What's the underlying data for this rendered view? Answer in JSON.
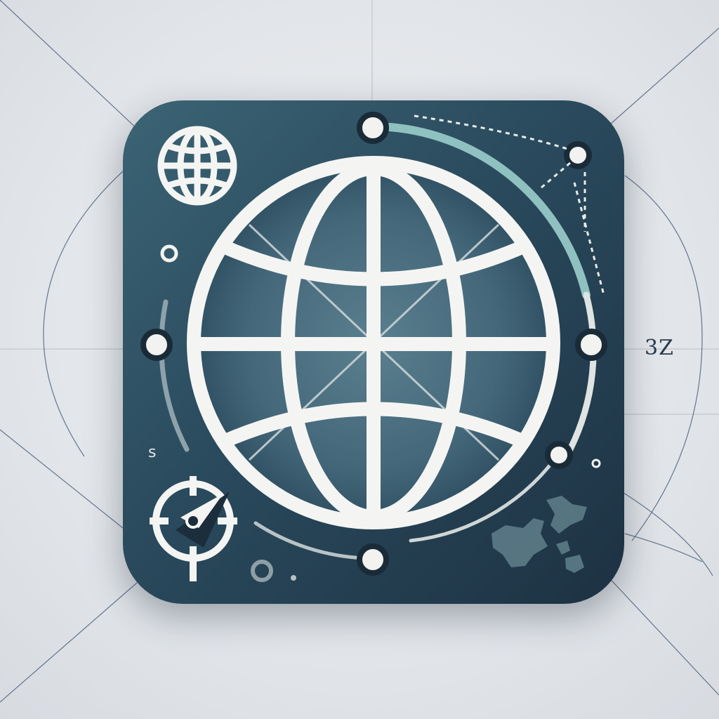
{
  "labels": {
    "side_number": "3Z",
    "side_letter": "s"
  },
  "icons": [
    "globe-icon",
    "small-globe-icon",
    "compass-icon",
    "world-map-icon"
  ],
  "colors": {
    "background": "#e4e7ea",
    "tile_dark": "#22384a",
    "tile_teal": "#4e7584",
    "globe_white": "#f4f5f3",
    "accent_teal": "#8fc1c0",
    "line_navy": "#2d4466"
  }
}
